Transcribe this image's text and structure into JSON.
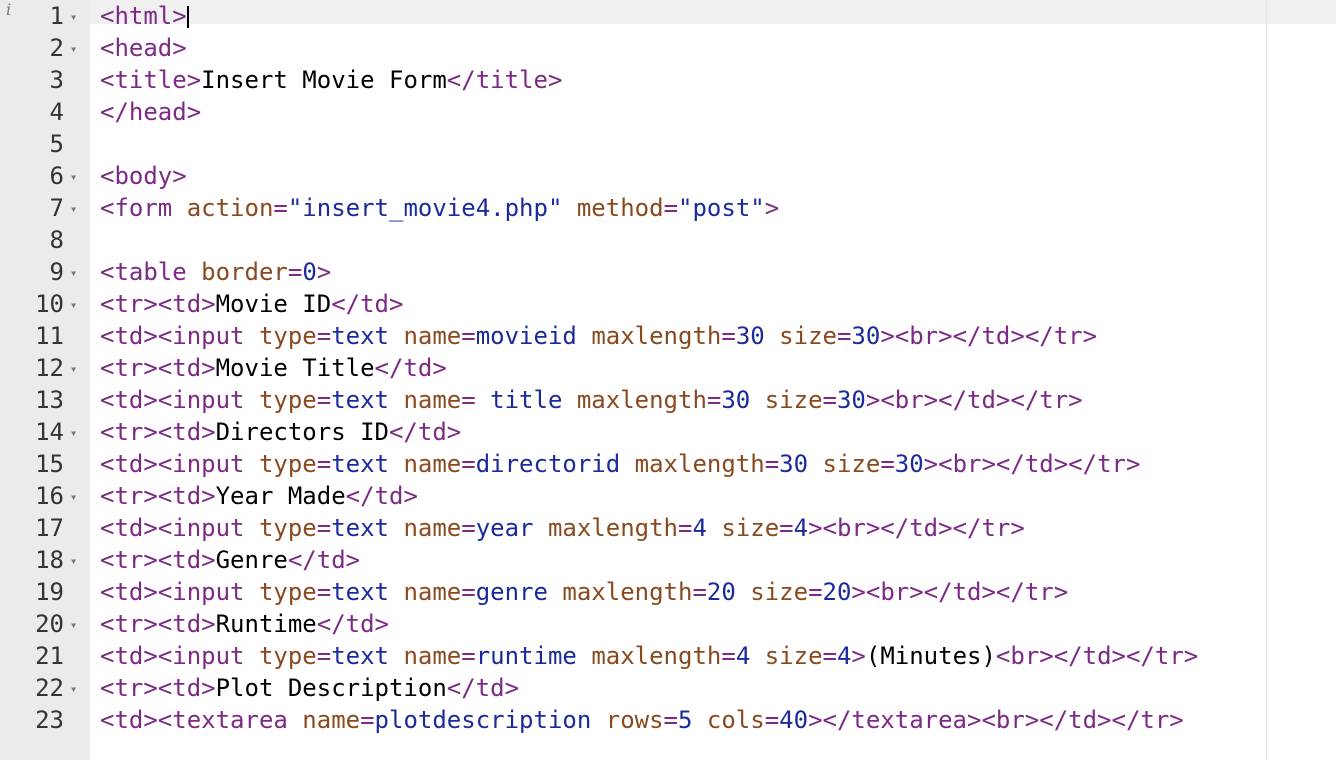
{
  "editor": {
    "info_icon": "info-icon",
    "lines": [
      {
        "n": "1",
        "fold": true,
        "tokens": [
          [
            "tag",
            "<html>"
          ]
        ],
        "cursor": true
      },
      {
        "n": "2",
        "fold": true,
        "tokens": [
          [
            "tag",
            "<head>"
          ]
        ]
      },
      {
        "n": "3",
        "fold": false,
        "tokens": [
          [
            "tag",
            "<title>"
          ],
          [
            "txt",
            "Insert Movie Form"
          ],
          [
            "tag",
            "</title>"
          ]
        ]
      },
      {
        "n": "4",
        "fold": false,
        "tokens": [
          [
            "tag",
            "</head>"
          ]
        ]
      },
      {
        "n": "5",
        "fold": false,
        "tokens": []
      },
      {
        "n": "6",
        "fold": true,
        "tokens": [
          [
            "tag",
            "<body>"
          ]
        ]
      },
      {
        "n": "7",
        "fold": true,
        "tokens": [
          [
            "tag",
            "<form "
          ],
          [
            "attr",
            "action"
          ],
          [
            "tag",
            "="
          ],
          [
            "val",
            "\"insert_movie4.php\""
          ],
          [
            "txt",
            " "
          ],
          [
            "attr",
            "method"
          ],
          [
            "tag",
            "="
          ],
          [
            "val",
            "\"post\""
          ],
          [
            "tag",
            ">"
          ]
        ]
      },
      {
        "n": "8",
        "fold": false,
        "tokens": []
      },
      {
        "n": "9",
        "fold": true,
        "tokens": [
          [
            "tag",
            "<table "
          ],
          [
            "attr",
            "border"
          ],
          [
            "tag",
            "="
          ],
          [
            "val",
            "0"
          ],
          [
            "tag",
            ">"
          ]
        ]
      },
      {
        "n": "10",
        "fold": true,
        "tokens": [
          [
            "tag",
            "<tr><td>"
          ],
          [
            "txt",
            "Movie ID"
          ],
          [
            "tag",
            "</td>"
          ]
        ]
      },
      {
        "n": "11",
        "fold": false,
        "tokens": [
          [
            "tag",
            "<td><input "
          ],
          [
            "attr",
            "type"
          ],
          [
            "tag",
            "="
          ],
          [
            "val",
            "text"
          ],
          [
            "txt",
            " "
          ],
          [
            "attr",
            "name"
          ],
          [
            "tag",
            "="
          ],
          [
            "val",
            "movieid"
          ],
          [
            "txt",
            " "
          ],
          [
            "attr",
            "maxlength"
          ],
          [
            "tag",
            "="
          ],
          [
            "val",
            "30"
          ],
          [
            "txt",
            " "
          ],
          [
            "attr",
            "size"
          ],
          [
            "tag",
            "="
          ],
          [
            "val",
            "30"
          ],
          [
            "tag",
            "><br></td></tr>"
          ]
        ]
      },
      {
        "n": "12",
        "fold": true,
        "tokens": [
          [
            "tag",
            "<tr><td>"
          ],
          [
            "txt",
            "Movie Title"
          ],
          [
            "tag",
            "</td>"
          ]
        ]
      },
      {
        "n": "13",
        "fold": false,
        "tokens": [
          [
            "tag",
            "<td><input "
          ],
          [
            "attr",
            "type"
          ],
          [
            "tag",
            "="
          ],
          [
            "val",
            "text"
          ],
          [
            "txt",
            " "
          ],
          [
            "attr",
            "name"
          ],
          [
            "tag",
            "="
          ],
          [
            "txt",
            " "
          ],
          [
            "val",
            "title"
          ],
          [
            "txt",
            " "
          ],
          [
            "attr",
            "maxlength"
          ],
          [
            "tag",
            "="
          ],
          [
            "val",
            "30"
          ],
          [
            "txt",
            " "
          ],
          [
            "attr",
            "size"
          ],
          [
            "tag",
            "="
          ],
          [
            "val",
            "30"
          ],
          [
            "tag",
            "><br></td></tr>"
          ]
        ]
      },
      {
        "n": "14",
        "fold": true,
        "tokens": [
          [
            "tag",
            "<tr><td>"
          ],
          [
            "txt",
            "Directors ID"
          ],
          [
            "tag",
            "</td>"
          ]
        ]
      },
      {
        "n": "15",
        "fold": false,
        "tokens": [
          [
            "tag",
            "<td><input "
          ],
          [
            "attr",
            "type"
          ],
          [
            "tag",
            "="
          ],
          [
            "val",
            "text"
          ],
          [
            "txt",
            " "
          ],
          [
            "attr",
            "name"
          ],
          [
            "tag",
            "="
          ],
          [
            "val",
            "directorid"
          ],
          [
            "txt",
            " "
          ],
          [
            "attr",
            "maxlength"
          ],
          [
            "tag",
            "="
          ],
          [
            "val",
            "30"
          ],
          [
            "txt",
            " "
          ],
          [
            "attr",
            "size"
          ],
          [
            "tag",
            "="
          ],
          [
            "val",
            "30"
          ],
          [
            "tag",
            "><br></td></tr>"
          ]
        ]
      },
      {
        "n": "16",
        "fold": true,
        "tokens": [
          [
            "tag",
            "<tr><td>"
          ],
          [
            "txt",
            "Year Made"
          ],
          [
            "tag",
            "</td>"
          ]
        ]
      },
      {
        "n": "17",
        "fold": false,
        "tokens": [
          [
            "tag",
            "<td><input "
          ],
          [
            "attr",
            "type"
          ],
          [
            "tag",
            "="
          ],
          [
            "val",
            "text"
          ],
          [
            "txt",
            " "
          ],
          [
            "attr",
            "name"
          ],
          [
            "tag",
            "="
          ],
          [
            "val",
            "year"
          ],
          [
            "txt",
            " "
          ],
          [
            "attr",
            "maxlength"
          ],
          [
            "tag",
            "="
          ],
          [
            "val",
            "4"
          ],
          [
            "txt",
            " "
          ],
          [
            "attr",
            "size"
          ],
          [
            "tag",
            "="
          ],
          [
            "val",
            "4"
          ],
          [
            "tag",
            "><br></td></tr>"
          ]
        ]
      },
      {
        "n": "18",
        "fold": true,
        "tokens": [
          [
            "tag",
            "<tr><td>"
          ],
          [
            "txt",
            "Genre"
          ],
          [
            "tag",
            "</td>"
          ]
        ]
      },
      {
        "n": "19",
        "fold": false,
        "tokens": [
          [
            "tag",
            "<td><input "
          ],
          [
            "attr",
            "type"
          ],
          [
            "tag",
            "="
          ],
          [
            "val",
            "text"
          ],
          [
            "txt",
            " "
          ],
          [
            "attr",
            "name"
          ],
          [
            "tag",
            "="
          ],
          [
            "val",
            "genre"
          ],
          [
            "txt",
            " "
          ],
          [
            "attr",
            "maxlength"
          ],
          [
            "tag",
            "="
          ],
          [
            "val",
            "20"
          ],
          [
            "txt",
            " "
          ],
          [
            "attr",
            "size"
          ],
          [
            "tag",
            "="
          ],
          [
            "val",
            "20"
          ],
          [
            "tag",
            "><br></td></tr>"
          ]
        ]
      },
      {
        "n": "20",
        "fold": true,
        "tokens": [
          [
            "tag",
            "<tr><td>"
          ],
          [
            "txt",
            "Runtime"
          ],
          [
            "tag",
            "</td>"
          ]
        ]
      },
      {
        "n": "21",
        "fold": false,
        "tokens": [
          [
            "tag",
            "<td><input "
          ],
          [
            "attr",
            "type"
          ],
          [
            "tag",
            "="
          ],
          [
            "val",
            "text"
          ],
          [
            "txt",
            " "
          ],
          [
            "attr",
            "name"
          ],
          [
            "tag",
            "="
          ],
          [
            "val",
            "runtime"
          ],
          [
            "txt",
            " "
          ],
          [
            "attr",
            "maxlength"
          ],
          [
            "tag",
            "="
          ],
          [
            "val",
            "4"
          ],
          [
            "txt",
            " "
          ],
          [
            "attr",
            "size"
          ],
          [
            "tag",
            "="
          ],
          [
            "val",
            "4"
          ],
          [
            "tag",
            ">"
          ],
          [
            "txt",
            "(Minutes)"
          ],
          [
            "tag",
            "<br></td></tr>"
          ]
        ]
      },
      {
        "n": "22",
        "fold": true,
        "tokens": [
          [
            "tag",
            "<tr><td>"
          ],
          [
            "txt",
            "Plot Description"
          ],
          [
            "tag",
            "</td>"
          ]
        ]
      },
      {
        "n": "23",
        "fold": false,
        "tokens": [
          [
            "tag",
            "<td><textarea "
          ],
          [
            "attr",
            "name"
          ],
          [
            "tag",
            "="
          ],
          [
            "val",
            "plotdescription"
          ],
          [
            "txt",
            " "
          ],
          [
            "attr",
            "rows"
          ],
          [
            "tag",
            "="
          ],
          [
            "val",
            "5"
          ],
          [
            "txt",
            " "
          ],
          [
            "attr",
            "cols"
          ],
          [
            "tag",
            "="
          ],
          [
            "val",
            "40"
          ],
          [
            "tag",
            "></textarea><br></td></tr>"
          ]
        ]
      }
    ]
  }
}
